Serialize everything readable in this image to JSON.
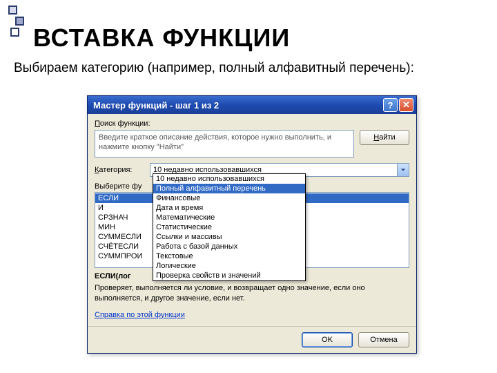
{
  "slide": {
    "title": "ВСТАВКА ФУНКЦИИ",
    "subtitle": "Выбираем категорию (например, полный алфавитный перечень):"
  },
  "dialog": {
    "title": "Мастер функций - шаг 1 из 2",
    "help_symbol": "?",
    "close_symbol": "✕",
    "search_label_pre": "П",
    "search_label_rest": "оиск функции:",
    "search_placeholder": "Введите краткое описание действия, которое нужно выполнить, и нажмите кнопку \"Найти\"",
    "find_pre": "Н",
    "find_rest": "айти",
    "category_label_pre": "К",
    "category_label_rest": "атегория:",
    "category_value": "10 недавно использовавшихся",
    "select_label": "Выберите фу",
    "functions": [
      "ЕСЛИ",
      "И",
      "СРЗНАЧ",
      "МИН",
      "СУММЕСЛИ",
      "СЧЁТЕСЛИ",
      "СУММПРОИ"
    ],
    "signature": "ЕСЛИ(лог",
    "description": "Проверяет, выполняется ли условие, и возвращает одно значение, если оно выполняется, и другое значение, если нет.",
    "help_link": "Справка по этой функции",
    "ok": "OK",
    "cancel": "Отмена"
  },
  "dropdown": {
    "options": [
      "10 недавно использовавшихся",
      "Полный алфавитный перечень",
      "Финансовые",
      "Дата и время",
      "Математические",
      "Статистические",
      "Ссылки и массивы",
      "Работа с базой данных",
      "Текстовые",
      "Логические",
      "Проверка свойств и значений"
    ],
    "highlight_index": 1
  }
}
